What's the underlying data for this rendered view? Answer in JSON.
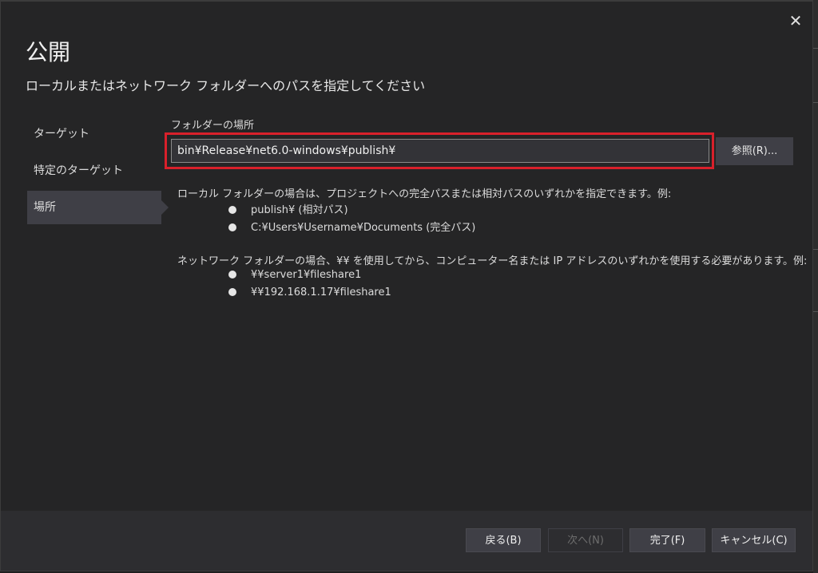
{
  "dialog": {
    "title": "公開",
    "subtitle": "ローカルまたはネットワーク フォルダーへのパスを指定してください",
    "close_icon": "close-icon"
  },
  "nav": {
    "items": [
      {
        "label": "ターゲット",
        "selected": false
      },
      {
        "label": "特定のターゲット",
        "selected": false
      },
      {
        "label": "場所",
        "selected": true
      }
    ]
  },
  "location": {
    "field_label": "フォルダーの場所",
    "path_value": "bin¥Release¥net6.0-windows¥publish¥",
    "browse_label": "参照(R)..."
  },
  "help": {
    "local_desc": "ローカル フォルダーの場合は、プロジェクトへの完全パスまたは相対パスのいずれかを指定できます。例:",
    "local_examples": [
      "publish¥ (相対パス)",
      "C:¥Users¥Username¥Documents (完全パス)"
    ],
    "network_desc": "ネットワーク フォルダーの場合、¥¥ を使用してから、コンピューター名または IP アドレスのいずれかを使用する必要があります。例:",
    "network_examples": [
      "¥¥server1¥fileshare1",
      "¥¥192.168.1.17¥fileshare1"
    ]
  },
  "footer": {
    "back_label": "戻る(B)",
    "next_label": "次へ(N)",
    "finish_label": "完了(F)",
    "cancel_label": "キャンセル(C)"
  },
  "colors": {
    "background": "#252526",
    "highlight_border": "#d9202b",
    "button": "#3f3f46"
  }
}
